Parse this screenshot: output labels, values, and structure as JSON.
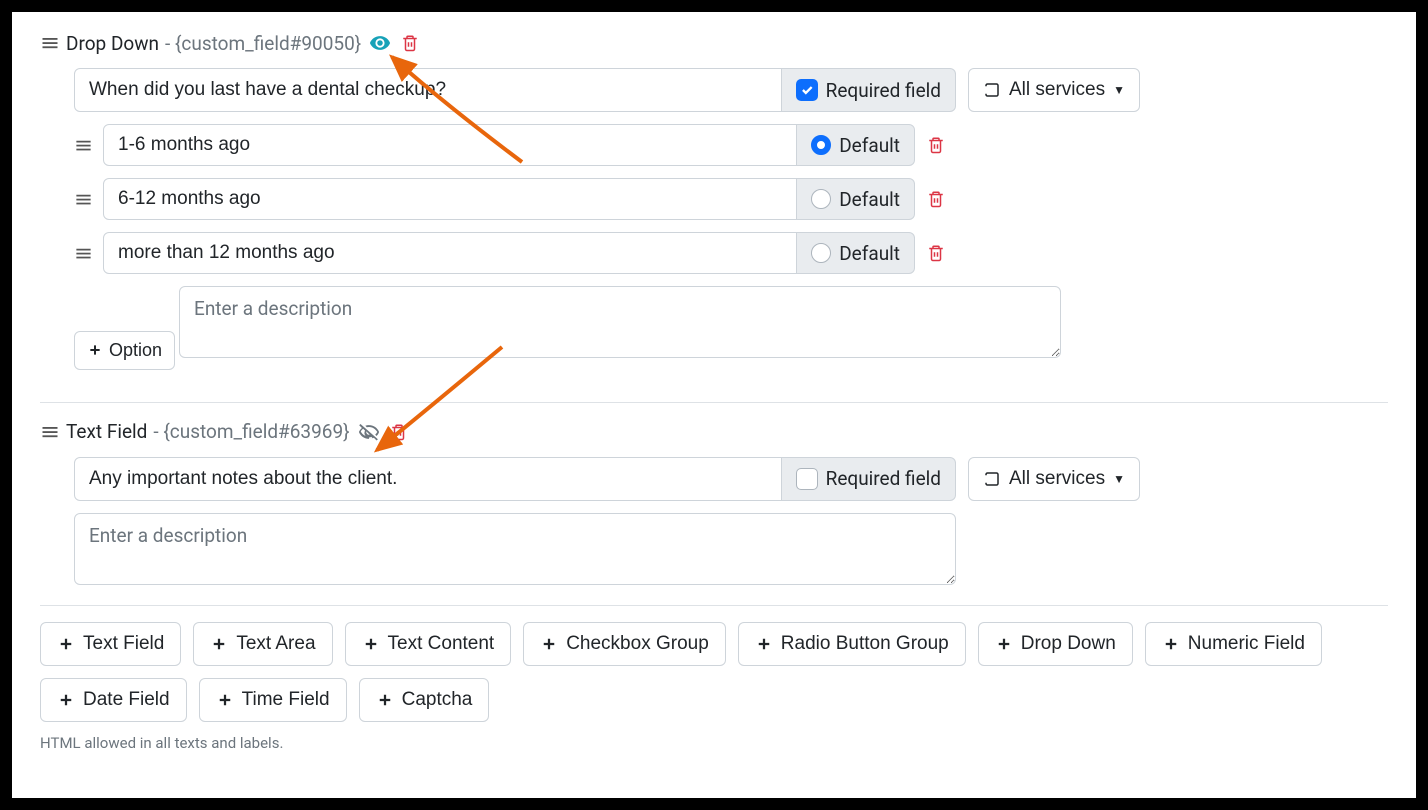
{
  "fields": [
    {
      "type_label": "Drop Down",
      "ref": "{custom_field#90050}",
      "visible": true,
      "label_value": "When did you last have a dental checkup?",
      "required": true,
      "required_label": "Required field",
      "services_label": "All services",
      "options": [
        {
          "value": "1-6 months ago",
          "default": true,
          "default_label": "Default"
        },
        {
          "value": "6-12 months ago",
          "default": false,
          "default_label": "Default"
        },
        {
          "value": "more than 12 months ago",
          "default": false,
          "default_label": "Default"
        }
      ],
      "add_option_label": "Option",
      "description_placeholder": "Enter a description",
      "description_value": ""
    },
    {
      "type_label": "Text Field",
      "ref": "{custom_field#63969}",
      "visible": false,
      "label_value": "Any important notes about the client.",
      "required": false,
      "required_label": "Required field",
      "services_label": "All services",
      "description_placeholder": "Enter a description",
      "description_value": ""
    }
  ],
  "toolbar": {
    "text_field": "Text Field",
    "text_area": "Text Area",
    "text_content": "Text Content",
    "checkbox_group": "Checkbox Group",
    "radio_button_group": "Radio Button Group",
    "drop_down": "Drop Down",
    "numeric_field": "Numeric Field",
    "date_field": "Date Field",
    "time_field": "Time Field",
    "captcha": "Captcha"
  },
  "footer_note": "HTML allowed in all texts and labels."
}
